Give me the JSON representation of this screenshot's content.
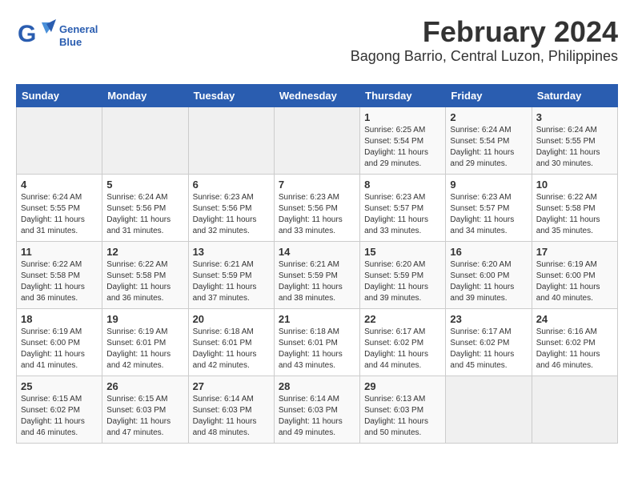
{
  "app": {
    "logo_general": "General",
    "logo_blue": "Blue"
  },
  "header": {
    "month_year": "February 2024",
    "location": "Bagong Barrio, Central Luzon, Philippines"
  },
  "days_of_week": [
    "Sunday",
    "Monday",
    "Tuesday",
    "Wednesday",
    "Thursday",
    "Friday",
    "Saturday"
  ],
  "weeks": [
    [
      {
        "day": "",
        "sunrise": "",
        "sunset": "",
        "daylight": ""
      },
      {
        "day": "",
        "sunrise": "",
        "sunset": "",
        "daylight": ""
      },
      {
        "day": "",
        "sunrise": "",
        "sunset": "",
        "daylight": ""
      },
      {
        "day": "",
        "sunrise": "",
        "sunset": "",
        "daylight": ""
      },
      {
        "day": "1",
        "sunrise": "Sunrise: 6:25 AM",
        "sunset": "Sunset: 5:54 PM",
        "daylight": "Daylight: 11 hours and 29 minutes."
      },
      {
        "day": "2",
        "sunrise": "Sunrise: 6:24 AM",
        "sunset": "Sunset: 5:54 PM",
        "daylight": "Daylight: 11 hours and 29 minutes."
      },
      {
        "day": "3",
        "sunrise": "Sunrise: 6:24 AM",
        "sunset": "Sunset: 5:55 PM",
        "daylight": "Daylight: 11 hours and 30 minutes."
      }
    ],
    [
      {
        "day": "4",
        "sunrise": "Sunrise: 6:24 AM",
        "sunset": "Sunset: 5:55 PM",
        "daylight": "Daylight: 11 hours and 31 minutes."
      },
      {
        "day": "5",
        "sunrise": "Sunrise: 6:24 AM",
        "sunset": "Sunset: 5:56 PM",
        "daylight": "Daylight: 11 hours and 31 minutes."
      },
      {
        "day": "6",
        "sunrise": "Sunrise: 6:23 AM",
        "sunset": "Sunset: 5:56 PM",
        "daylight": "Daylight: 11 hours and 32 minutes."
      },
      {
        "day": "7",
        "sunrise": "Sunrise: 6:23 AM",
        "sunset": "Sunset: 5:56 PM",
        "daylight": "Daylight: 11 hours and 33 minutes."
      },
      {
        "day": "8",
        "sunrise": "Sunrise: 6:23 AM",
        "sunset": "Sunset: 5:57 PM",
        "daylight": "Daylight: 11 hours and 33 minutes."
      },
      {
        "day": "9",
        "sunrise": "Sunrise: 6:23 AM",
        "sunset": "Sunset: 5:57 PM",
        "daylight": "Daylight: 11 hours and 34 minutes."
      },
      {
        "day": "10",
        "sunrise": "Sunrise: 6:22 AM",
        "sunset": "Sunset: 5:58 PM",
        "daylight": "Daylight: 11 hours and 35 minutes."
      }
    ],
    [
      {
        "day": "11",
        "sunrise": "Sunrise: 6:22 AM",
        "sunset": "Sunset: 5:58 PM",
        "daylight": "Daylight: 11 hours and 36 minutes."
      },
      {
        "day": "12",
        "sunrise": "Sunrise: 6:22 AM",
        "sunset": "Sunset: 5:58 PM",
        "daylight": "Daylight: 11 hours and 36 minutes."
      },
      {
        "day": "13",
        "sunrise": "Sunrise: 6:21 AM",
        "sunset": "Sunset: 5:59 PM",
        "daylight": "Daylight: 11 hours and 37 minutes."
      },
      {
        "day": "14",
        "sunrise": "Sunrise: 6:21 AM",
        "sunset": "Sunset: 5:59 PM",
        "daylight": "Daylight: 11 hours and 38 minutes."
      },
      {
        "day": "15",
        "sunrise": "Sunrise: 6:20 AM",
        "sunset": "Sunset: 5:59 PM",
        "daylight": "Daylight: 11 hours and 39 minutes."
      },
      {
        "day": "16",
        "sunrise": "Sunrise: 6:20 AM",
        "sunset": "Sunset: 6:00 PM",
        "daylight": "Daylight: 11 hours and 39 minutes."
      },
      {
        "day": "17",
        "sunrise": "Sunrise: 6:19 AM",
        "sunset": "Sunset: 6:00 PM",
        "daylight": "Daylight: 11 hours and 40 minutes."
      }
    ],
    [
      {
        "day": "18",
        "sunrise": "Sunrise: 6:19 AM",
        "sunset": "Sunset: 6:00 PM",
        "daylight": "Daylight: 11 hours and 41 minutes."
      },
      {
        "day": "19",
        "sunrise": "Sunrise: 6:19 AM",
        "sunset": "Sunset: 6:01 PM",
        "daylight": "Daylight: 11 hours and 42 minutes."
      },
      {
        "day": "20",
        "sunrise": "Sunrise: 6:18 AM",
        "sunset": "Sunset: 6:01 PM",
        "daylight": "Daylight: 11 hours and 42 minutes."
      },
      {
        "day": "21",
        "sunrise": "Sunrise: 6:18 AM",
        "sunset": "Sunset: 6:01 PM",
        "daylight": "Daylight: 11 hours and 43 minutes."
      },
      {
        "day": "22",
        "sunrise": "Sunrise: 6:17 AM",
        "sunset": "Sunset: 6:02 PM",
        "daylight": "Daylight: 11 hours and 44 minutes."
      },
      {
        "day": "23",
        "sunrise": "Sunrise: 6:17 AM",
        "sunset": "Sunset: 6:02 PM",
        "daylight": "Daylight: 11 hours and 45 minutes."
      },
      {
        "day": "24",
        "sunrise": "Sunrise: 6:16 AM",
        "sunset": "Sunset: 6:02 PM",
        "daylight": "Daylight: 11 hours and 46 minutes."
      }
    ],
    [
      {
        "day": "25",
        "sunrise": "Sunrise: 6:15 AM",
        "sunset": "Sunset: 6:02 PM",
        "daylight": "Daylight: 11 hours and 46 minutes."
      },
      {
        "day": "26",
        "sunrise": "Sunrise: 6:15 AM",
        "sunset": "Sunset: 6:03 PM",
        "daylight": "Daylight: 11 hours and 47 minutes."
      },
      {
        "day": "27",
        "sunrise": "Sunrise: 6:14 AM",
        "sunset": "Sunset: 6:03 PM",
        "daylight": "Daylight: 11 hours and 48 minutes."
      },
      {
        "day": "28",
        "sunrise": "Sunrise: 6:14 AM",
        "sunset": "Sunset: 6:03 PM",
        "daylight": "Daylight: 11 hours and 49 minutes."
      },
      {
        "day": "29",
        "sunrise": "Sunrise: 6:13 AM",
        "sunset": "Sunset: 6:03 PM",
        "daylight": "Daylight: 11 hours and 50 minutes."
      },
      {
        "day": "",
        "sunrise": "",
        "sunset": "",
        "daylight": ""
      },
      {
        "day": "",
        "sunrise": "",
        "sunset": "",
        "daylight": ""
      }
    ]
  ]
}
